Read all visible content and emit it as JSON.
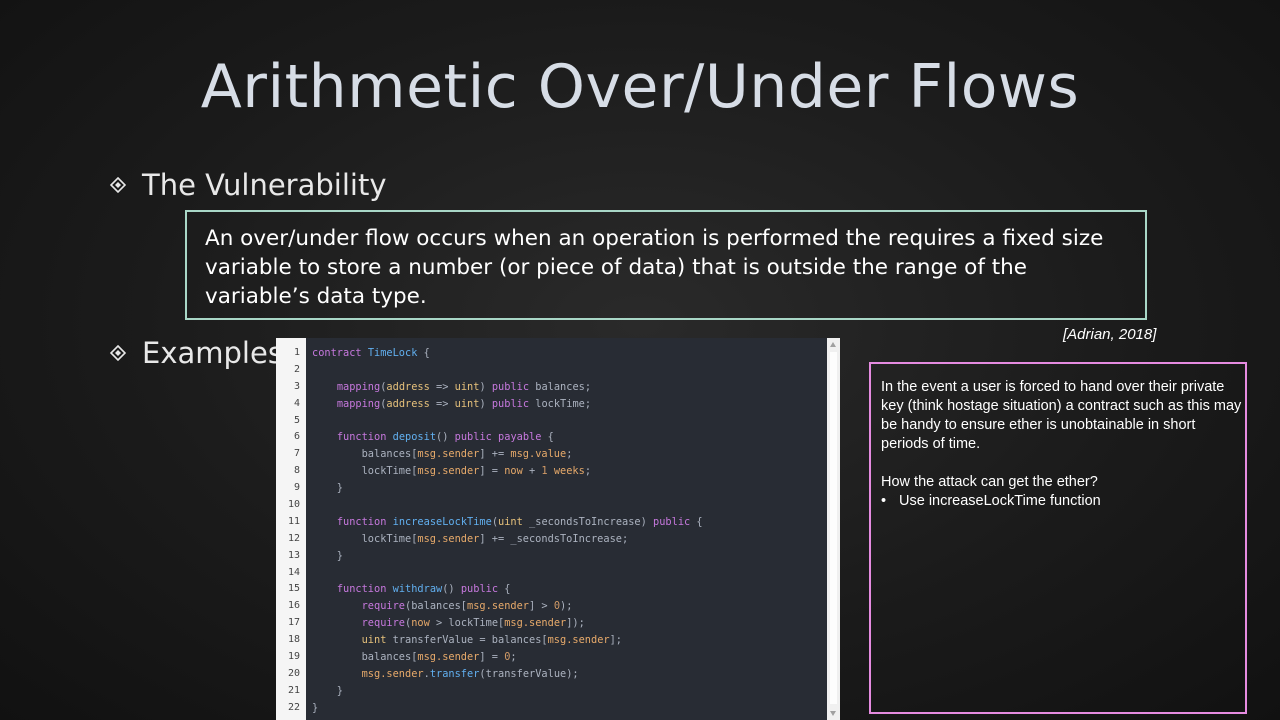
{
  "slide": {
    "title": "Arithmetic Over/Under Flows",
    "bullets": [
      {
        "text": "The Vulnerability"
      },
      {
        "text": "Examples"
      }
    ],
    "definition": "An over/under flow occurs when an operation is performed the requires a fixed size variable to store a number (or piece of data) that is outside the range of the variable’s data type.",
    "citation": "[Adrian, 2018]",
    "note": {
      "paragraph": "In the event a user is forced to hand over their private key (think hostage situation) a contract such as this may be handy to ensure ether is unobtainable in short periods of time.",
      "question": "How the attack can get the ether?",
      "list": [
        "Use increaseLockTime function"
      ]
    },
    "code": {
      "line_numbers": [
        "1",
        "2",
        "3",
        "4",
        "5",
        "6",
        "7",
        "8",
        "9",
        "10",
        "11",
        "12",
        "13",
        "14",
        "15",
        "16",
        "17",
        "18",
        "19",
        "20",
        "21",
        "22"
      ],
      "lines": [
        "contract TimeLock {",
        "",
        "    mapping(address => uint) public balances;",
        "    mapping(address => uint) public lockTime;",
        "",
        "    function deposit() public payable {",
        "        balances[msg.sender] += msg.value;",
        "        lockTime[msg.sender] = now + 1 weeks;",
        "    }",
        "",
        "    function increaseLockTime(uint _secondsToIncrease) public {",
        "        lockTime[msg.sender] += _secondsToIncrease;",
        "    }",
        "",
        "    function withdraw() public {",
        "        require(balances[msg.sender] > 0);",
        "        require(now > lockTime[msg.sender]);",
        "        uint transferValue = balances[msg.sender];",
        "        balances[msg.sender] = 0;",
        "        msg.sender.transfer(transferValue);",
        "    }",
        "}"
      ]
    }
  }
}
